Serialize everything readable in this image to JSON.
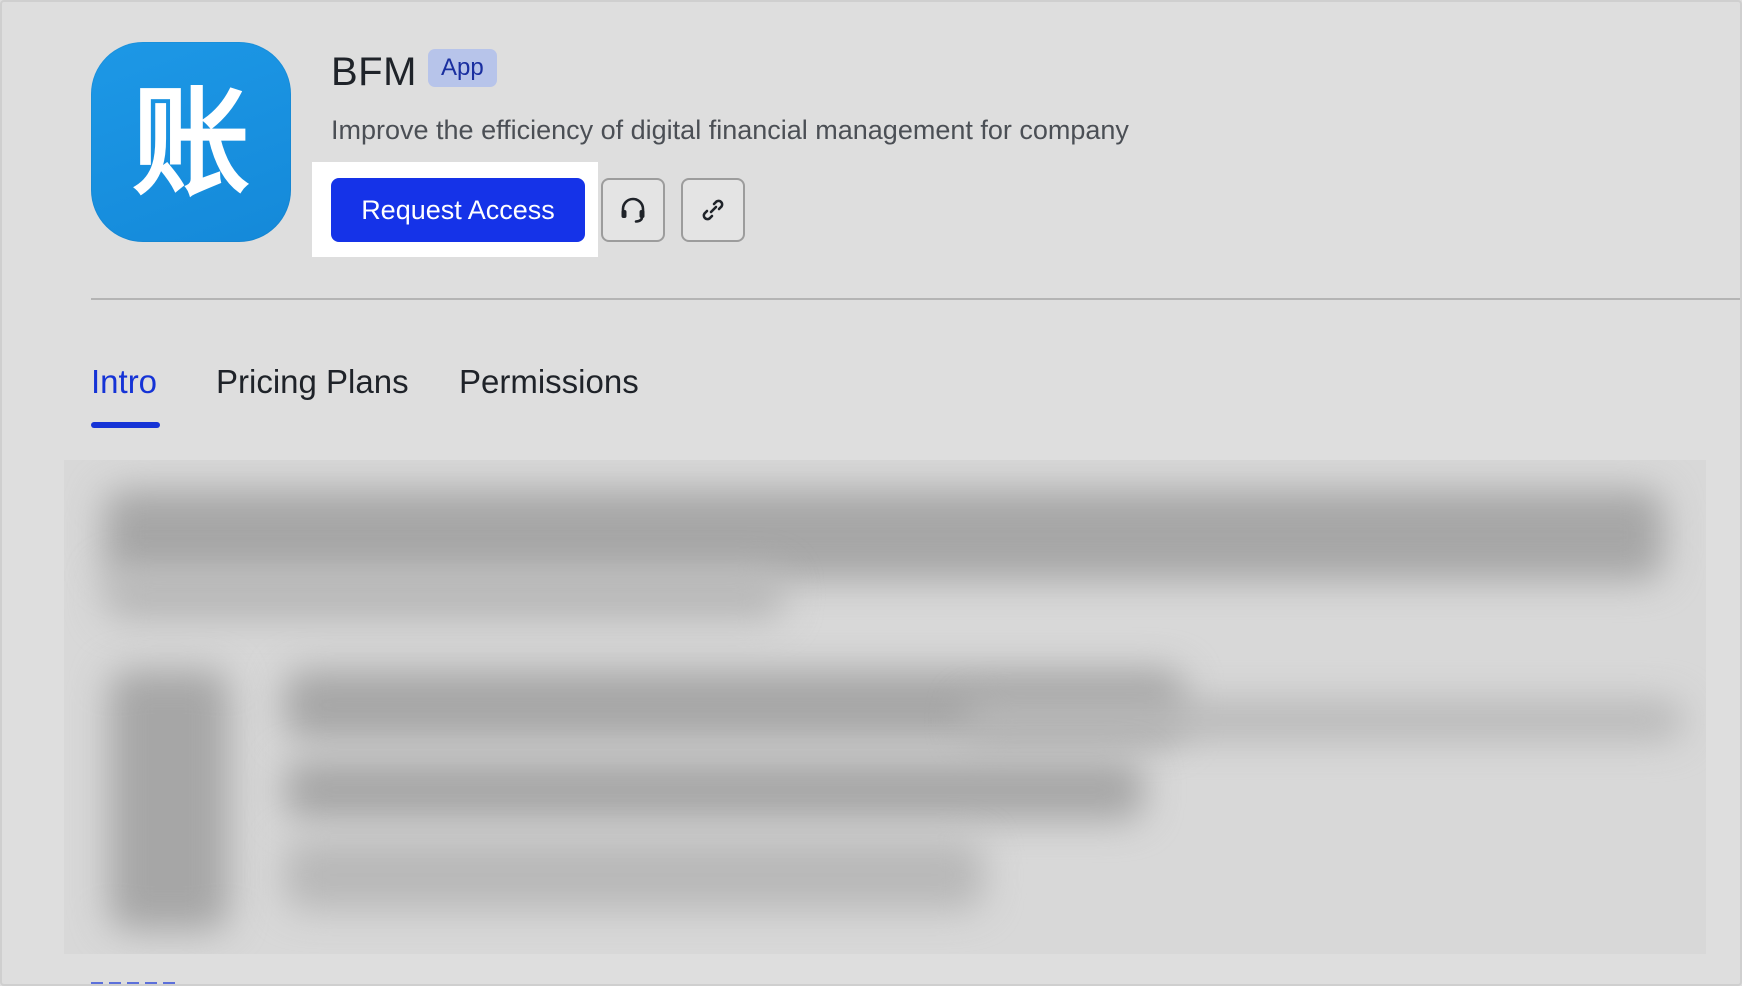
{
  "app": {
    "name": "BFM",
    "badge": "App",
    "description": "Improve the efficiency of digital financial management for company",
    "icon_name": "ledger-app-icon",
    "icon_glyph": "账",
    "icon_color": "#1d98e6"
  },
  "actions": {
    "request_label": "Request Access",
    "request_color": "#1533e8",
    "support_icon": "headset-icon",
    "link_icon": "link-icon"
  },
  "tabs": [
    {
      "label": "Intro",
      "active": true
    },
    {
      "label": "Pricing Plans",
      "active": false
    },
    {
      "label": "Permissions",
      "active": false
    }
  ],
  "colors": {
    "accent": "#1533d6",
    "background": "#dedede",
    "badge_bg": "#b7c4ea"
  }
}
